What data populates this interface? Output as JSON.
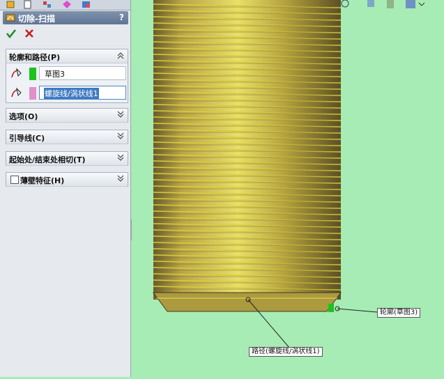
{
  "panel": {
    "title": "切除-扫描",
    "help": "?",
    "ok_tooltip_icon": "check-icon",
    "cancel_icon": "x-icon",
    "groups": {
      "profile_path": {
        "label": "轮廓和路径(P)",
        "profile_value": "草图3",
        "profile_color": "#1ec21e",
        "path_value": "螺旋线/涡状线1",
        "path_color": "#e38fc9"
      },
      "options": {
        "label": "选项(O)"
      },
      "guides": {
        "label": "引导线(C)"
      },
      "tangency": {
        "label": "起始处/结束处相切(T)"
      },
      "thin": {
        "label": "薄壁特征(H)",
        "checked": false
      }
    }
  },
  "viewport": {
    "callout_profile": "轮廓(草图3)",
    "callout_path": "路径(螺旋线/涡状线1)",
    "thread_color": "#d7cc3a",
    "background": "#a6ecb4"
  }
}
